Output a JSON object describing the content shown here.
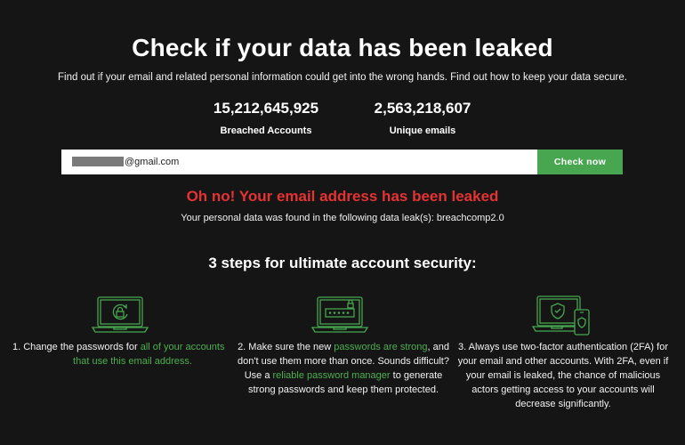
{
  "hero": {
    "title": "Check if your data has been leaked",
    "subtitle": "Find out if your email and related personal information could get into the wrong hands. Find out how to keep your data secure."
  },
  "stats": [
    {
      "value": "15,212,645,925",
      "label": "Breached Accounts"
    },
    {
      "value": "2,563,218,607",
      "label": "Unique emails"
    }
  ],
  "search": {
    "email_value": "@gmail.com",
    "button_label": "Check now"
  },
  "result": {
    "title": "Oh no! Your email address has been leaked",
    "message": "Your personal data was found in the following data leak(s): breachcomp2.0"
  },
  "steps_title": "3 steps for ultimate account security:",
  "steps": [
    {
      "text_1": "1. Change the passwords for ",
      "link_1": "all of your accounts",
      "link_2": "that use this email address."
    },
    {
      "text_1": "2. Make sure the new ",
      "link_1": "passwords are strong",
      "text_2": ", and don't use them more than once. Sounds difficult? Use a ",
      "link_2": "reliable password manager",
      "text_3": " to generate strong passwords and keep them protected."
    },
    {
      "text_1": "3. Always use two-factor authentication (2FA) for your email and other accounts. With 2FA, even if your email is leaked, the chance of malicious actors getting access to your accounts will decrease significantly."
    }
  ],
  "colors": {
    "background": "#151515",
    "accent_green": "#47a64f",
    "link_green": "#4caf50",
    "alert_red": "#e53333"
  },
  "icons": [
    "laptop-refresh-icon",
    "laptop-password-icon",
    "laptop-phone-shield-icon"
  ]
}
